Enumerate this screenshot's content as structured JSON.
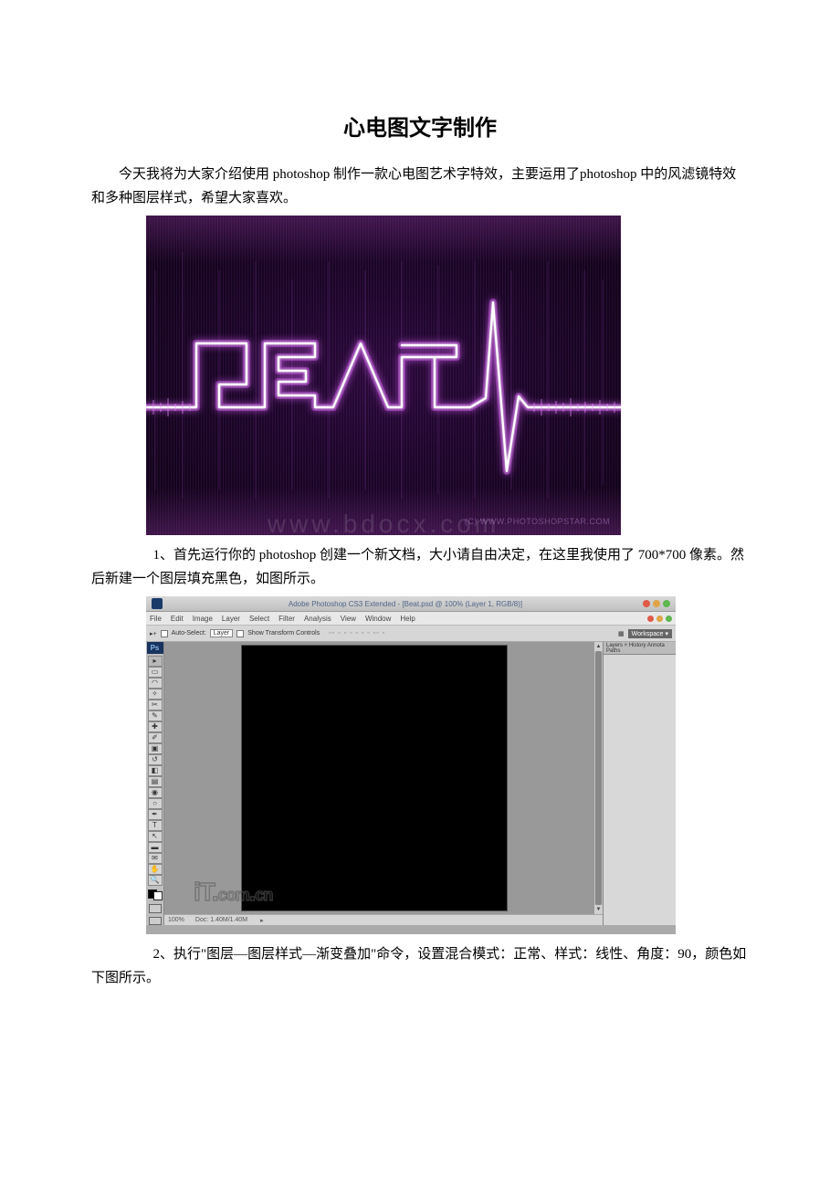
{
  "title": "心电图文字制作",
  "intro": "今天我将为大家介绍使用 photoshop 制作一款心电图艺术字特效，主要运用了photoshop 中的风滤镜特效和多种图层样式，希望大家喜欢。",
  "figure1": {
    "bottom_watermark": "(C) WWW.PHOTOSHOPSTAR.COM",
    "overlay_watermark": "www.bdocx.com"
  },
  "step1": "1、首先运行你的 photoshop 创建一个新文档，大小请自由决定，在这里我使用了 700*700 像素。然后新建一个图层填充黑色，如图所示。",
  "photoshop": {
    "title": "Adobe Photoshop CS3 Extended - [Beat.psd @ 100% (Layer 1, RGB/8)]",
    "menus": [
      "File",
      "Edit",
      "Image",
      "Layer",
      "Select",
      "Filter",
      "Analysis",
      "View",
      "Window",
      "Help"
    ],
    "optbar": {
      "auto_select_label": "Auto-Select:",
      "auto_select_value": "Layer",
      "show_transform": "Show Transform Controls",
      "workspace": "Workspace ▾"
    },
    "status": {
      "zoom": "100%",
      "doc": "Doc: 1.40M/1.40M"
    },
    "panel_tabs": "Layers × History Annota Paths",
    "watermark": "iT.com.cn"
  },
  "step2": "2、执行\"图层—图层样式—渐变叠加\"命令，设置混合模式：正常、样式：线性、角度：90，颜色如下图所示。"
}
